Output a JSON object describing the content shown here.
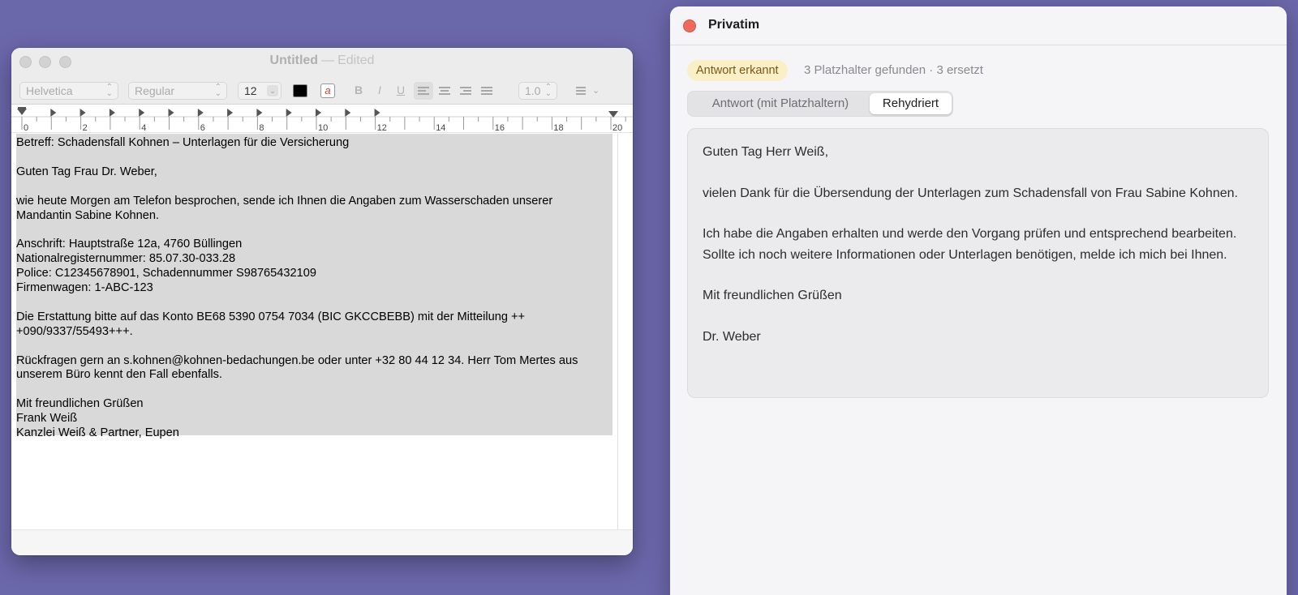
{
  "textedit": {
    "title": "Untitled",
    "title_separator": "—",
    "title_status": "Edited",
    "toolbar": {
      "font_family": "Helvetica",
      "font_style": "Regular",
      "font_size": "12",
      "line_spacing": "1.0",
      "bold_label": "B",
      "italic_label": "I",
      "underline_label": "U",
      "highlight_label": "a"
    },
    "ruler_labels": [
      "0",
      "2",
      "4",
      "6",
      "8",
      "10",
      "12",
      "14",
      "16",
      "18",
      "20"
    ],
    "paragraphs": [
      "Betreff: Schadensfall Kohnen – Unterlagen für die Versicherung",
      "Guten Tag Frau Dr. Weber,",
      "wie heute Morgen am Telefon besprochen, sende ich Ihnen die Angaben zum Wasserschaden unserer Mandantin Sabine Kohnen.",
      "Anschrift: Hauptstraße 12a, 4760 Büllingen\nNationalregisternummer: 85.07.30-033.28\nPolice: C12345678901, Schadennummer S98765432109\nFirmenwagen: 1-ABC-123",
      "Die Erstattung bitte auf das Konto BE68 5390 0754 7034 (BIC GKCCBEBB) mit der Mitteilung ++\n+090/9337/55493+++.",
      "Rückfragen gern an s.kohnen@kohnen-bedachungen.be oder unter +32 80 44 12 34. Herr Tom Mertes aus unserem Büro kennt den Fall ebenfalls.",
      "Mit freundlichen Grüßen\nFrank Weiß\nKanzlei Weiß & Partner, Eupen"
    ]
  },
  "privatim": {
    "title": "Privatim",
    "badge": "Antwort erkannt",
    "status": "3 Platzhalter gefunden · 3 ersetzt",
    "segments": {
      "placeholder": "Antwort (mit Platzhaltern)",
      "rehydrated": "Rehydriert",
      "selected": "Rehydriert"
    },
    "reply_paragraphs": [
      "Guten Tag Herr Weiß,",
      "vielen Dank für die Übersendung der Unterlagen zum Schadensfall von Frau Sabine Kohnen.",
      "Ich habe die Angaben erhalten und werde den Vorgang prüfen und entsprechend bearbeiten. Sollte ich noch weitere Informationen oder Unterlagen benötigen, melde ich mich bei Ihnen.",
      "Mit freundlichen Grüßen",
      "Dr. Weber"
    ]
  }
}
